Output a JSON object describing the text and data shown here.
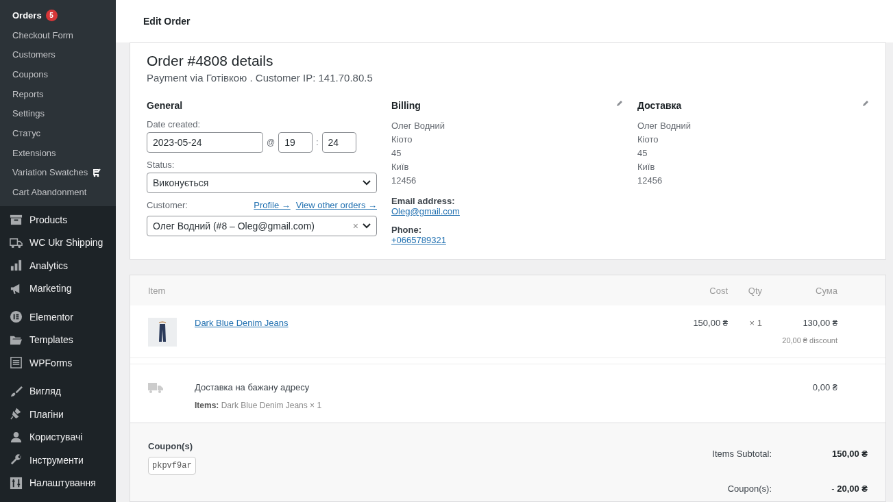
{
  "sidebar": {
    "submenu": [
      {
        "label": "Orders",
        "selected": true,
        "badge": "5"
      },
      {
        "label": "Checkout Form",
        "selected": false
      },
      {
        "label": "Customers",
        "selected": false
      },
      {
        "label": "Coupons",
        "selected": false
      },
      {
        "label": "Reports",
        "selected": false
      },
      {
        "label": "Settings",
        "selected": false
      },
      {
        "label": "Статус",
        "selected": false
      },
      {
        "label": "Extensions",
        "selected": false
      },
      {
        "label": "Variation Swatches",
        "selected": false
      },
      {
        "label": "Cart Abandonment",
        "selected": false
      }
    ],
    "menu_groups": [
      [
        {
          "label": "Products"
        },
        {
          "label": "WC Ukr Shipping"
        },
        {
          "label": "Analytics"
        },
        {
          "label": "Marketing"
        }
      ],
      [
        {
          "label": "Elementor"
        },
        {
          "label": "Templates"
        },
        {
          "label": "WPForms"
        }
      ],
      [
        {
          "label": "Вигляд"
        },
        {
          "label": "Плагіни"
        },
        {
          "label": "Користувачі"
        },
        {
          "label": "Інструменти"
        },
        {
          "label": "Налаштування"
        }
      ]
    ]
  },
  "header": {
    "title": "Edit Order"
  },
  "order": {
    "title": "Order #4808 details",
    "subtitle": "Payment via Готівкою . Customer IP: 141.70.80.5",
    "general": {
      "heading": "General",
      "date_label": "Date created:",
      "date": "2023-05-24",
      "at": "@",
      "hour": "19",
      "colon": ":",
      "minute": "24",
      "status_label": "Status:",
      "status": "Виконується",
      "customer_label": "Customer:",
      "profile_link": "Profile →",
      "orders_link": "View other orders →",
      "customer": "Олег Водний (#8 – Oleg@gmail.com)",
      "clear": "×"
    },
    "billing": {
      "heading": "Billing",
      "lines": [
        "Олег Водний",
        "Кіото",
        "45",
        "Київ",
        "12456"
      ],
      "email_label": "Email address:",
      "email": "Oleg@gmail.com",
      "phone_label": "Phone:",
      "phone": "+0665789321"
    },
    "shipping": {
      "heading": "Доставка",
      "lines": [
        "Олег Водний",
        "Кіото",
        "45",
        "Київ",
        "12456"
      ]
    }
  },
  "items": {
    "columns": [
      "Item",
      "Cost",
      "Qty",
      "Сума"
    ],
    "product": {
      "name": "Dark Blue Denim Jeans",
      "cost": "150,00 ₴",
      "qty": "× 1",
      "total": "130,00 ₴",
      "discount": "20,00 ₴ discount"
    },
    "shipping": {
      "name": "Доставка на бажану адресу",
      "items_label": "Items:",
      "items": "Dark Blue Denim Jeans × 1",
      "total": "0,00 ₴"
    },
    "coupons_label": "Coupon(s)",
    "coupon": "pkpvf9ar",
    "totals": [
      {
        "label": "Items Subtotal:",
        "value": "**150,00 ₴**"
      },
      {
        "label": "Coupon(s):",
        "value": "- **20,00 ₴**"
      }
    ]
  }
}
